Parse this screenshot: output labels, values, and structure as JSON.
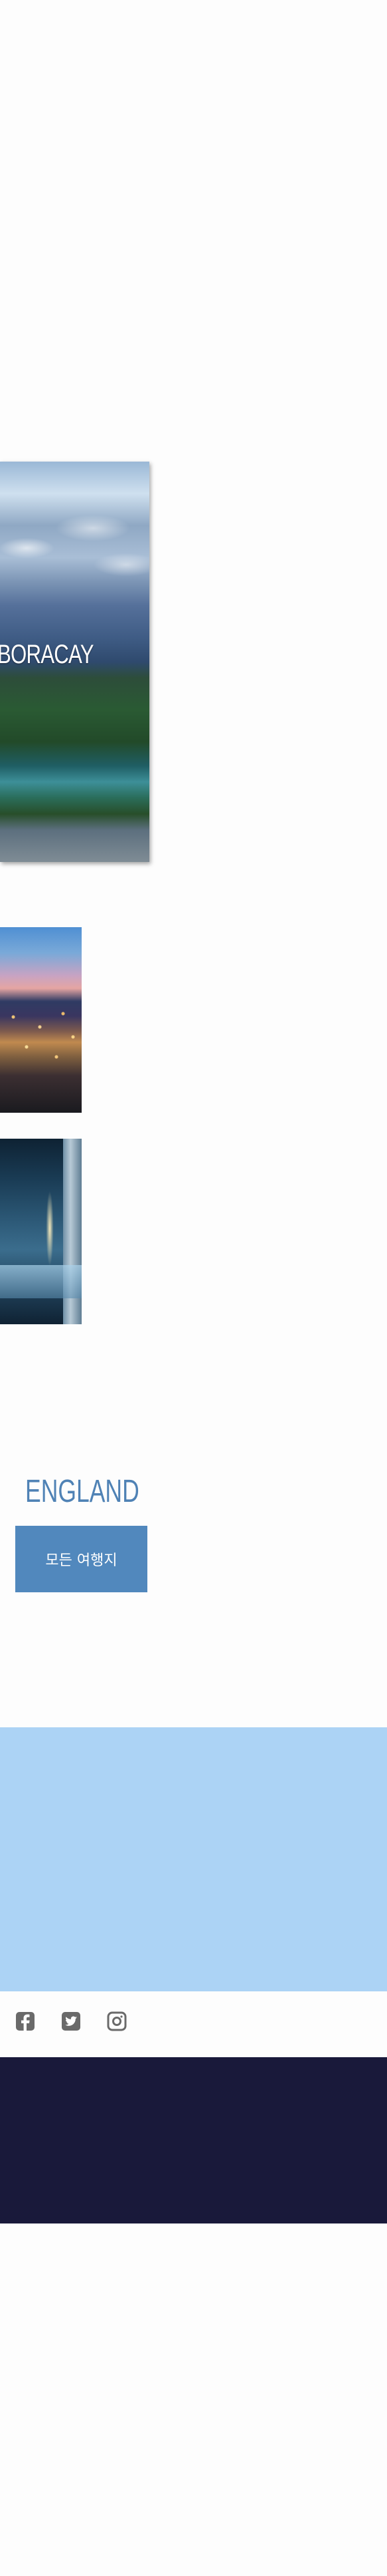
{
  "hero": {
    "title": "BORACAY"
  },
  "thumbnails": [
    {
      "icon": "night-city-photo"
    },
    {
      "icon": "night-building-photo"
    }
  ],
  "destination": {
    "name": "ENGLAND",
    "cta_label": "모든 여행지"
  },
  "social": [
    {
      "icon": "facebook-icon"
    },
    {
      "icon": "twitter-icon"
    },
    {
      "icon": "instagram-icon"
    }
  ],
  "colors": {
    "accent": "#5188bd",
    "heading": "#4f82b5",
    "band": "#acd3f5",
    "footer": "#19193a",
    "social_icon": "#6a6a6a"
  }
}
